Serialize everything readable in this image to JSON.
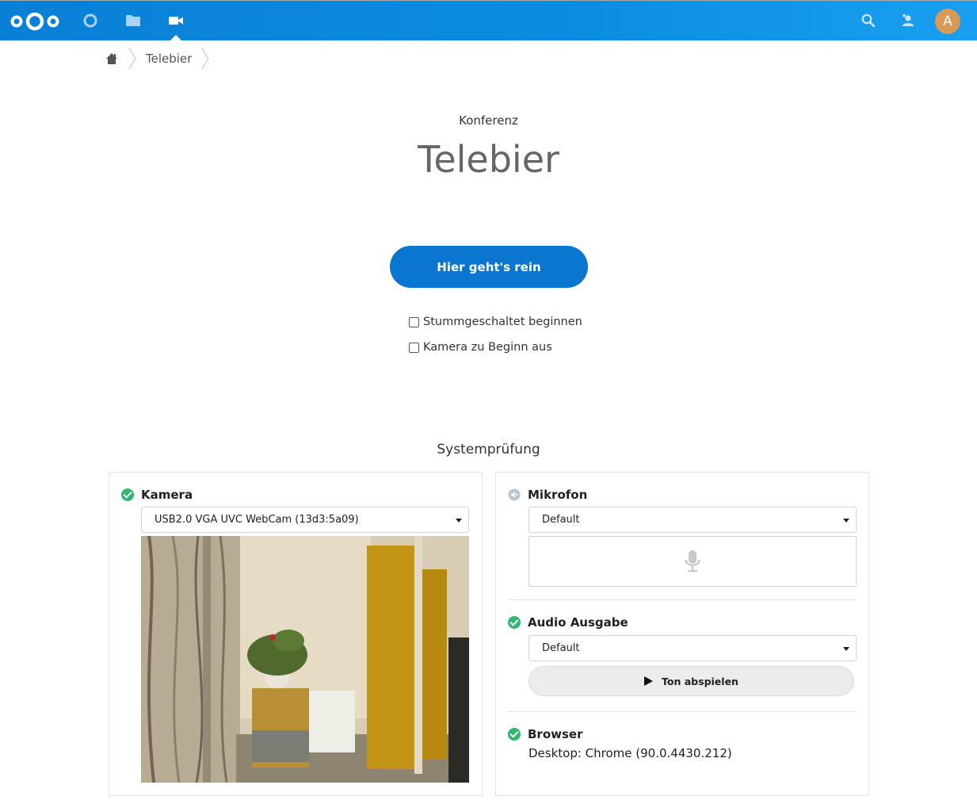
{
  "header": {
    "apps": [
      {
        "name": "dashboard"
      },
      {
        "name": "files"
      },
      {
        "name": "talk",
        "active": true
      }
    ],
    "avatar_letter": "A",
    "accent": "#0b7bd8"
  },
  "breadcrumb": {
    "current": "Telebier"
  },
  "conversation": {
    "subtitle": "Konferenz",
    "title": "Telebier",
    "join_label": "Hier geht's rein",
    "options": [
      {
        "label": "Stummgeschaltet beginnen",
        "checked": false
      },
      {
        "label": "Kamera zu Beginn aus",
        "checked": false
      }
    ]
  },
  "system_check": {
    "title": "Systemprüfung",
    "camera": {
      "label": "Kamera",
      "status": "ok",
      "device": "USB2.0 VGA UVC WebCam (13d3:5a09)"
    },
    "microphone": {
      "label": "Mikrofon",
      "status": "neutral",
      "device": "Default"
    },
    "audio_output": {
      "label": "Audio Ausgabe",
      "status": "ok",
      "device": "Default",
      "play_label": "Ton abspielen"
    },
    "browser": {
      "label": "Browser",
      "status": "ok",
      "value": "Desktop: Chrome (90.0.4430.212)"
    }
  }
}
